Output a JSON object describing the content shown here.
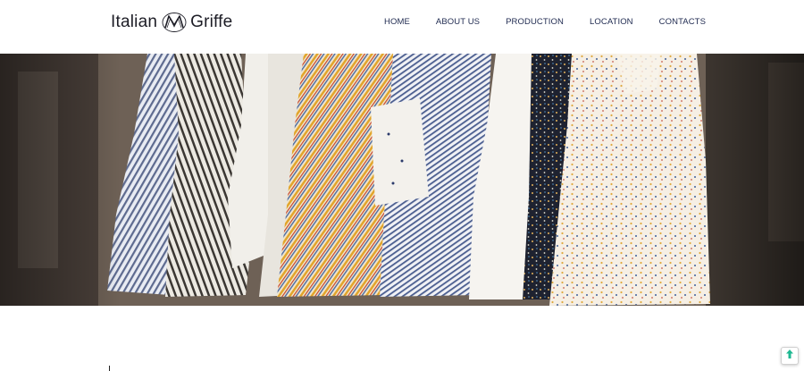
{
  "brand": {
    "name_left": "Italian",
    "name_right": "Griffe",
    "logo_icon": "monogram-m-icon"
  },
  "nav": {
    "items": [
      {
        "label": "HOME"
      },
      {
        "label": "ABOUT US"
      },
      {
        "label": "PRODUCTION"
      },
      {
        "label": "LOCATION"
      },
      {
        "label": "CONTACTS"
      }
    ]
  },
  "hero": {
    "image": "clothing-rack-photo"
  },
  "back_to_top": {
    "icon": "arrow-up-icon",
    "color": "#1fb892"
  },
  "colors": {
    "nav_text": "#1f2a50",
    "logo_text": "#1d1d26"
  }
}
